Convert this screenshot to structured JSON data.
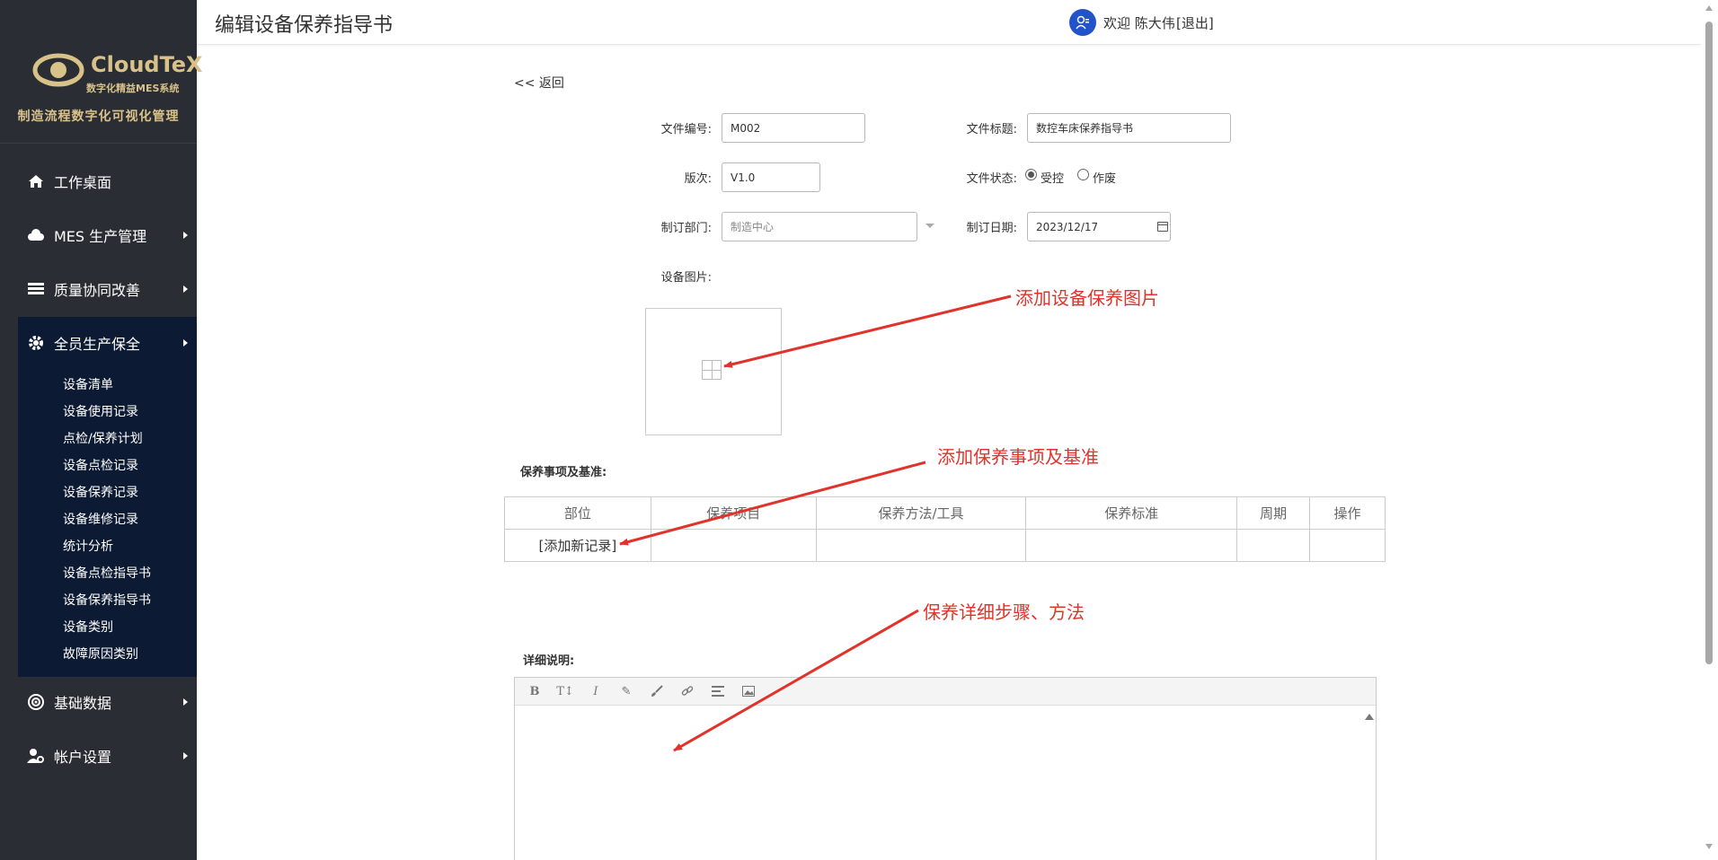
{
  "sidebar": {
    "brand": "CloudTeX",
    "brand_sub": "数字化精益MES系统",
    "tagline": "制造流程数字化可视化管理",
    "menu": [
      {
        "label": "工作桌面",
        "icon": "home-icon"
      },
      {
        "label": "MES 生产管理",
        "icon": "cloud-icon"
      },
      {
        "label": "质量协同改善",
        "icon": "stack-icon"
      },
      {
        "label": "全员生产保全",
        "icon": "gear-icon"
      },
      {
        "label": "基础数据",
        "icon": "target-icon"
      },
      {
        "label": "帐户设置",
        "icon": "user-gear-icon"
      }
    ],
    "submenu": [
      "设备清单",
      "设备使用记录",
      "点检/保养计划",
      "设备点检记录",
      "设备保养记录",
      "设备维修记录",
      "统计分析",
      "设备点检指导书",
      "设备保养指导书",
      "设备类别",
      "故障原因类别"
    ]
  },
  "header": {
    "title": "编辑设备保养指导书",
    "welcome": "欢迎 陈大伟",
    "logout": "[退出]"
  },
  "form": {
    "back": "<< 返回",
    "doc_no_label": "文件编号:",
    "doc_no": "M002",
    "doc_title_label": "文件标题:",
    "doc_title": "数控车床保养指导书",
    "version_label": "版次:",
    "version": "V1.0",
    "status_label": "文件状态:",
    "status_options": [
      "受控",
      "作废"
    ],
    "status_selected": "受控",
    "dept_label": "制订部门:",
    "dept": "制造中心",
    "date_label": "制订日期:",
    "date": "2023/12/17",
    "image_label": "设备图片:",
    "items_label": "保养事项及基准:",
    "table_headers": [
      "部位",
      "保养项目",
      "保养方法/工具",
      "保养标准",
      "周期",
      "操作"
    ],
    "add_record": "[添加新记录]",
    "detail_label": "详细说明:"
  },
  "editor": {
    "toolbar": [
      "bold-icon",
      "text-size-icon",
      "italic-icon",
      "pen-icon",
      "brush-icon",
      "link-icon",
      "align-icon",
      "image-icon"
    ]
  },
  "annotations": {
    "image": "添加设备保养图片",
    "items": "添加保养事项及基准",
    "detail": "保养详细步骤、方法",
    "color": "#e0332b"
  }
}
